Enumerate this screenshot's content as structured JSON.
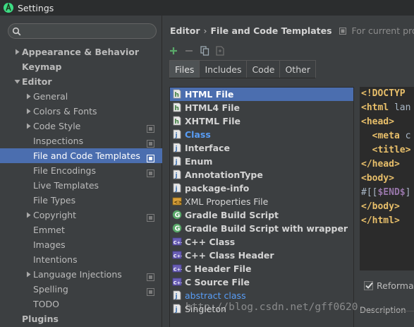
{
  "window": {
    "title": "Settings"
  },
  "sidebar": {
    "search_placeholder": "",
    "items": [
      {
        "label": "Appearance & Behavior",
        "level": 0,
        "bold": true,
        "arrow": "right",
        "project": false
      },
      {
        "label": "Keymap",
        "level": 0,
        "bold": true,
        "arrow": "",
        "project": false
      },
      {
        "label": "Editor",
        "level": 0,
        "bold": true,
        "arrow": "down",
        "project": false
      },
      {
        "label": "General",
        "level": 1,
        "bold": false,
        "arrow": "right",
        "project": false
      },
      {
        "label": "Colors & Fonts",
        "level": 1,
        "bold": false,
        "arrow": "right",
        "project": false
      },
      {
        "label": "Code Style",
        "level": 1,
        "bold": false,
        "arrow": "right",
        "project": true
      },
      {
        "label": "Inspections",
        "level": 1,
        "bold": false,
        "arrow": "",
        "project": true
      },
      {
        "label": "File and Code Templates",
        "level": 1,
        "bold": false,
        "arrow": "",
        "project": true,
        "selected": true
      },
      {
        "label": "File Encodings",
        "level": 1,
        "bold": false,
        "arrow": "",
        "project": true
      },
      {
        "label": "Live Templates",
        "level": 1,
        "bold": false,
        "arrow": "",
        "project": false
      },
      {
        "label": "File Types",
        "level": 1,
        "bold": false,
        "arrow": "",
        "project": false
      },
      {
        "label": "Copyright",
        "level": 1,
        "bold": false,
        "arrow": "right",
        "project": true
      },
      {
        "label": "Emmet",
        "level": 1,
        "bold": false,
        "arrow": "",
        "project": false
      },
      {
        "label": "Images",
        "level": 1,
        "bold": false,
        "arrow": "",
        "project": false
      },
      {
        "label": "Intentions",
        "level": 1,
        "bold": false,
        "arrow": "",
        "project": false
      },
      {
        "label": "Language Injections",
        "level": 1,
        "bold": false,
        "arrow": "right",
        "project": true
      },
      {
        "label": "Spelling",
        "level": 1,
        "bold": false,
        "arrow": "",
        "project": true
      },
      {
        "label": "TODO",
        "level": 1,
        "bold": false,
        "arrow": "",
        "project": false
      },
      {
        "label": "Plugins",
        "level": 0,
        "bold": true,
        "arrow": "",
        "project": false
      }
    ]
  },
  "main": {
    "breadcrumb": {
      "parent": "Editor",
      "separator": "›",
      "current": "File and Code Templates",
      "scope": "For current project"
    },
    "tabs": [
      {
        "label": "Files",
        "active": true
      },
      {
        "label": "Includes",
        "active": false
      },
      {
        "label": "Code",
        "active": false
      },
      {
        "label": "Other",
        "active": false
      }
    ],
    "templates": [
      {
        "name": "HTML File",
        "icon": "html-file-icon",
        "style": "bold",
        "selected": true
      },
      {
        "name": "HTML4 File",
        "icon": "html-file-icon",
        "style": "bold"
      },
      {
        "name": "XHTML File",
        "icon": "html-file-icon",
        "style": "bold"
      },
      {
        "name": "Class",
        "icon": "java-file-icon",
        "style": "blue-bold"
      },
      {
        "name": "Interface",
        "icon": "java-file-icon",
        "style": "bold"
      },
      {
        "name": "Enum",
        "icon": "java-file-icon",
        "style": "bold"
      },
      {
        "name": "AnnotationType",
        "icon": "java-file-icon",
        "style": "bold"
      },
      {
        "name": "package-info",
        "icon": "java-file-icon",
        "style": "bold"
      },
      {
        "name": "XML Properties File",
        "icon": "xml-file-icon",
        "style": "normal"
      },
      {
        "name": "Gradle Build Script",
        "icon": "gradle-icon",
        "style": "bold"
      },
      {
        "name": "Gradle Build Script with wrapper",
        "icon": "gradle-icon",
        "style": "bold"
      },
      {
        "name": "C++ Class",
        "icon": "cpp-icon",
        "style": "bold"
      },
      {
        "name": "C++ Class Header",
        "icon": "cpp-icon",
        "style": "bold"
      },
      {
        "name": "C Header File",
        "icon": "cpp-icon",
        "style": "bold"
      },
      {
        "name": "C Source File",
        "icon": "cpp-icon",
        "style": "bold"
      },
      {
        "name": "abstract class",
        "icon": "java-file-icon",
        "style": "blue-normal"
      },
      {
        "name": "Singleton",
        "icon": "java-file-icon",
        "style": "normal"
      }
    ],
    "editor_lines": [
      [
        {
          "t": "<!DOCTYP",
          "c": "kw"
        }
      ],
      [
        {
          "t": "<html ",
          "c": "kw"
        },
        {
          "t": "lan",
          "c": "tx"
        }
      ],
      [
        {
          "t": "<head>",
          "c": "kw"
        }
      ],
      [
        {
          "t": "  <meta ",
          "c": "kw"
        },
        {
          "t": "c",
          "c": "tx"
        }
      ],
      [
        {
          "t": "  <title>",
          "c": "kw"
        }
      ],
      [
        {
          "t": "</head>",
          "c": "kw"
        }
      ],
      [
        {
          "t": "<body>",
          "c": "kw"
        }
      ],
      [
        {
          "t": "#[[",
          "c": "tx"
        },
        {
          "t": "$END$",
          "c": "var"
        },
        {
          "t": "]",
          "c": "tx"
        }
      ],
      [
        {
          "t": "</body>",
          "c": "kw"
        }
      ],
      [
        {
          "t": "</html>",
          "c": "kw"
        }
      ]
    ],
    "reformat_label": "Reformat",
    "reformat_checked": true,
    "description_label": "Description",
    "watermark": "http://blog.csdn.net/gff0620"
  },
  "colors": {
    "selection": "#4b6eaf",
    "background": "#3c3f41",
    "editor_bg": "#2b2b2b",
    "tag": "#e8bf6a",
    "add": "#59a869"
  }
}
